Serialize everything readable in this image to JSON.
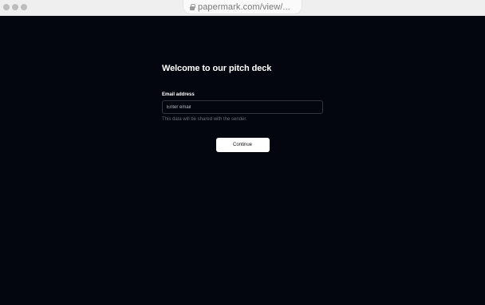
{
  "browser": {
    "url": "papermark.com/view/...",
    "url_icon": "lock-icon"
  },
  "form": {
    "title": "Welcome to our pitch deck",
    "email_label": "Email address",
    "email_placeholder": "Enter email",
    "email_value": "",
    "helper_text": "This data will be shared with the sender.",
    "continue_label": "Continue"
  },
  "colors": {
    "background": "#03060f",
    "button_bg": "#ffffff",
    "input_border": "#33363f"
  }
}
